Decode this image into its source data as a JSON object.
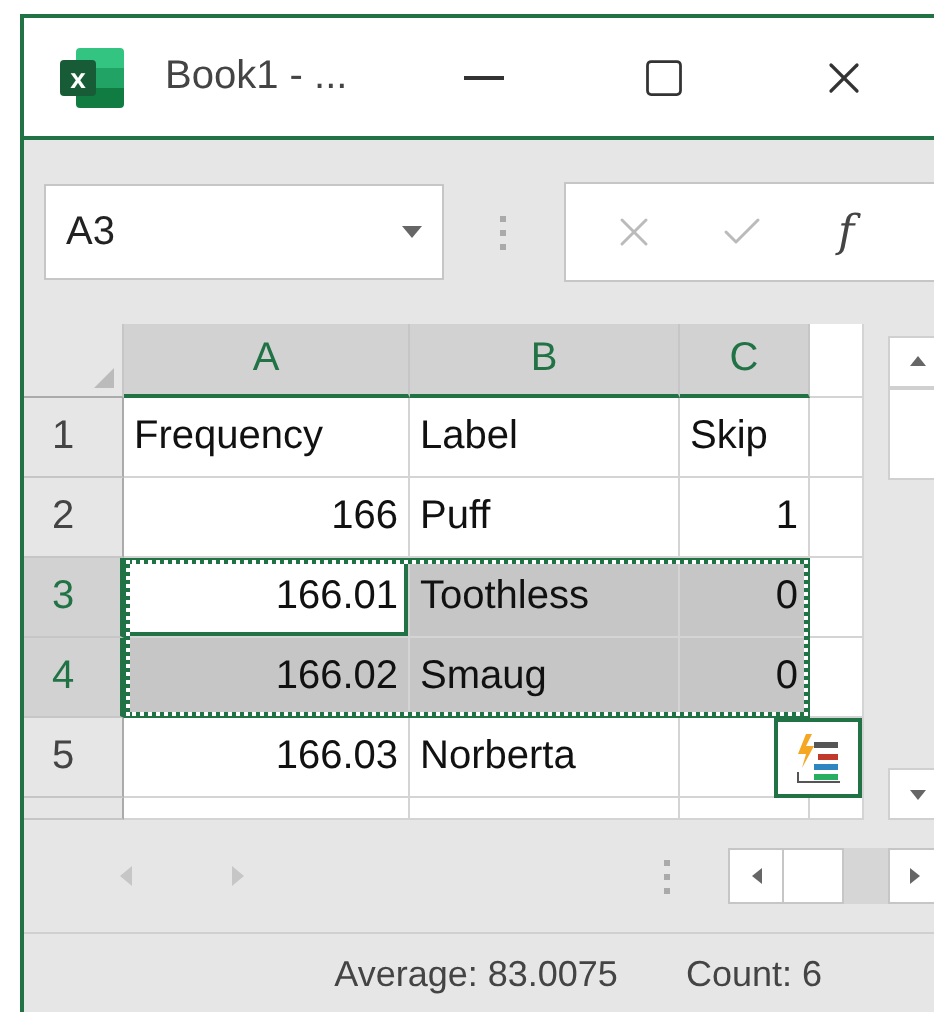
{
  "window": {
    "logo_letter": "x",
    "title": "Book1 - ..."
  },
  "formula_bar": {
    "name_box": "A3",
    "function_label": "f"
  },
  "columns": [
    {
      "label": "A",
      "selected": true
    },
    {
      "label": "B",
      "selected": true
    },
    {
      "label": "C",
      "selected": true
    }
  ],
  "rows": [
    {
      "number": "1",
      "selected": false,
      "cells": [
        {
          "text": "Frequency",
          "kind": "text",
          "active": false
        },
        {
          "text": "Label",
          "kind": "text",
          "active": false
        },
        {
          "text": "Skip",
          "kind": "text",
          "active": false
        }
      ]
    },
    {
      "number": "2",
      "selected": false,
      "cells": [
        {
          "text": "166",
          "kind": "number",
          "active": false
        },
        {
          "text": "Puff",
          "kind": "text",
          "active": false
        },
        {
          "text": "1",
          "kind": "number",
          "active": false
        }
      ]
    },
    {
      "number": "3",
      "selected": true,
      "cells": [
        {
          "text": "166.01",
          "kind": "number",
          "active": true
        },
        {
          "text": "Toothless",
          "kind": "text",
          "active": false
        },
        {
          "text": "0",
          "kind": "number",
          "active": false
        }
      ]
    },
    {
      "number": "4",
      "selected": true,
      "cells": [
        {
          "text": "166.02",
          "kind": "number",
          "active": false
        },
        {
          "text": "Smaug",
          "kind": "text",
          "active": false
        },
        {
          "text": "0",
          "kind": "number",
          "active": false
        }
      ]
    },
    {
      "number": "5",
      "selected": false,
      "cells": [
        {
          "text": "166.03",
          "kind": "number",
          "active": false
        },
        {
          "text": "Norberta",
          "kind": "text",
          "active": false
        },
        {
          "text": "",
          "kind": "text",
          "active": false
        }
      ]
    }
  ],
  "status_bar": [
    "Average: 83.0075",
    "Count: 6"
  ]
}
